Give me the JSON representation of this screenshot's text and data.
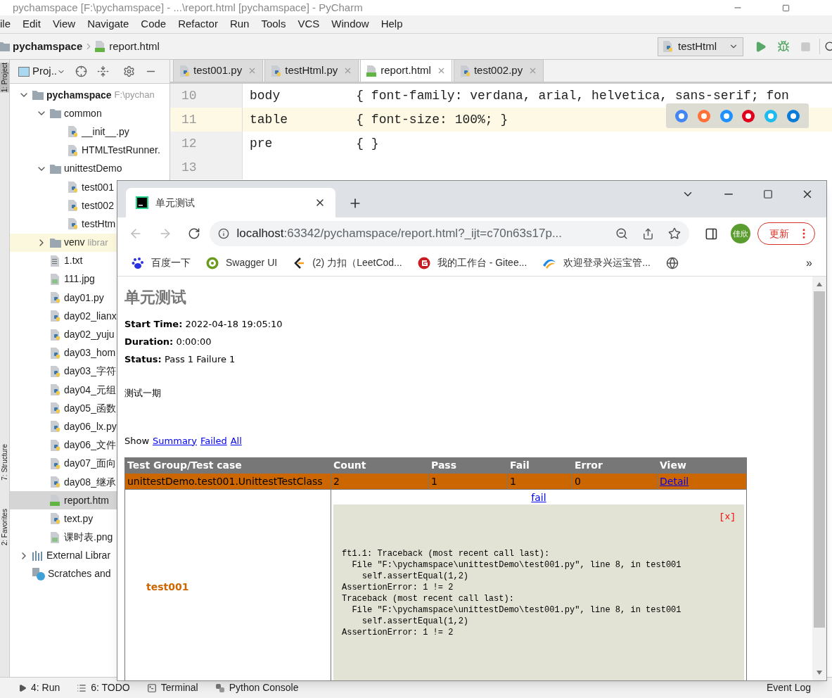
{
  "window": {
    "title": "pychamspace [F:\\pychamspace] - ...\\report.html [pychamspace] - PyCharm"
  },
  "menu": [
    "ile",
    "Edit",
    "View",
    "Navigate",
    "Code",
    "Refactor",
    "Run",
    "Tools",
    "VCS",
    "Window",
    "Help"
  ],
  "breadcrumb": [
    {
      "label": "pychamspace",
      "kind": "folder"
    },
    {
      "label": "report.html",
      "kind": "html"
    }
  ],
  "run_config": {
    "label": "testHtml"
  },
  "left_stripe": [
    {
      "label": "1: Project",
      "selected": true
    },
    {
      "label": "7: Structure",
      "selected": false
    },
    {
      "label": "2: Favorites",
      "selected": false
    }
  ],
  "project_panel": {
    "title": "Proj..",
    "tree": [
      {
        "label": "pychamspace",
        "hint": "F:\\pychan",
        "kind": "folder",
        "expanded": true,
        "selected": false,
        "children": [
          {
            "label": "common",
            "kind": "folder",
            "expanded": true,
            "selected": false,
            "children": [
              {
                "label": "__init__.py",
                "kind": "py",
                "selected": false
              },
              {
                "label": "HTMLTestRunner.",
                "kind": "py",
                "selected": false
              }
            ]
          },
          {
            "label": "unittestDemo",
            "kind": "folder",
            "expanded": true,
            "selected": false,
            "children": [
              {
                "label": "test001",
                "kind": "py",
                "selected": false
              },
              {
                "label": "test002",
                "kind": "py",
                "selected": false
              },
              {
                "label": "testHtm",
                "kind": "py",
                "selected": false
              }
            ]
          },
          {
            "label": "venv",
            "hint": "librar",
            "kind": "library",
            "expanded": false,
            "selected": false
          },
          {
            "label": "1.txt",
            "kind": "txt",
            "selected": false
          },
          {
            "label": "111.jpg",
            "kind": "image",
            "selected": false
          },
          {
            "label": "day01.py",
            "kind": "py",
            "selected": false
          },
          {
            "label": "day02_lianx",
            "kind": "py",
            "selected": false
          },
          {
            "label": "day02_yuju",
            "kind": "py",
            "selected": false
          },
          {
            "label": "day03_hom",
            "kind": "py",
            "selected": false
          },
          {
            "label": "day03_字符",
            "kind": "py",
            "selected": false
          },
          {
            "label": "day04_元组",
            "kind": "py",
            "selected": false
          },
          {
            "label": "day05_函数",
            "kind": "py",
            "selected": false
          },
          {
            "label": "day06_lx.py",
            "kind": "py",
            "selected": false
          },
          {
            "label": "day06_文件",
            "kind": "py",
            "selected": false
          },
          {
            "label": "day07_面向",
            "kind": "py",
            "selected": false
          },
          {
            "label": "day08_继承",
            "kind": "py",
            "selected": false
          },
          {
            "label": "report.htm",
            "kind": "html",
            "selected": true
          },
          {
            "label": "text.py",
            "kind": "py",
            "selected": false
          },
          {
            "label": "课时表.png",
            "kind": "image",
            "selected": false
          }
        ]
      },
      {
        "label": "External Librar",
        "kind": "libs",
        "expanded": false,
        "selected": false
      },
      {
        "label": "Scratches and",
        "kind": "scratch",
        "selected": false
      }
    ]
  },
  "editor": {
    "tabs": [
      {
        "label": "test001.py",
        "kind": "py",
        "selected": false
      },
      {
        "label": "testHtml.py",
        "kind": "py",
        "selected": false
      },
      {
        "label": "report.html",
        "kind": "html",
        "selected": true
      },
      {
        "label": "test002.py",
        "kind": "py",
        "selected": false
      }
    ],
    "lines": [
      {
        "number": "10",
        "text": "body          { font-family: verdana, arial, helvetica, sans-serif; fon",
        "current": false
      },
      {
        "number": "11",
        "text": "table         { font-size: 100%; }",
        "current": true
      },
      {
        "number": "12",
        "text": "pre           { }",
        "current": false
      },
      {
        "number": "13",
        "current": false
      }
    ]
  },
  "browser": {
    "tab_title": "单元测试",
    "address_host": "localhost",
    "address_rest": ":63342/pychamspace/report.html?_ijt=c70n63s17p...",
    "avatar": "佳欣",
    "update_button": "更新",
    "bookmarks": [
      {
        "label": "百度一下",
        "kind": "paw"
      },
      {
        "label": "Swagger UI",
        "kind": "swagger"
      },
      {
        "label": "(2) 力扣（LeetCod...",
        "kind": "leetcode"
      },
      {
        "label": "我的工作台 - Gitee...",
        "kind": "gitee"
      },
      {
        "label": "欢迎登录兴运宝管...",
        "kind": "swirl"
      },
      {
        "kind": "globe"
      }
    ],
    "more": "»",
    "page": {
      "title": "单元测试",
      "meta": [
        {
          "label": "Start Time:",
          "value": "2022-04-18 19:05:10"
        },
        {
          "label": "Duration:",
          "value": "0:00:00"
        },
        {
          "label": "Status:",
          "value": "Pass 1 Failure 1"
        }
      ],
      "description": "测试一期",
      "filter": {
        "label": "Show",
        "links": [
          "Summary",
          "Failed",
          "All"
        ]
      },
      "table": {
        "columns": [
          "Test Group/Test case",
          "Count",
          "Pass",
          "Fail",
          "Error",
          "View"
        ],
        "rows": [
          {
            "color": "#cc6600",
            "cells": [
              "unittestDemo.test001.UnittestTestClass",
              "2",
              "1",
              "1",
              "0"
            ],
            "link": "Detail"
          }
        ]
      },
      "detail": {
        "test": "test001",
        "link": "fail",
        "close": "[x]",
        "trace": "ft1.1: Traceback (most recent call last):\n  File \"F:\\pychamspace\\unittestDemo\\test001.py\", line 8, in test001\n    self.assertEqual(1,2)\nAssertionError: 1 != 2\nTraceback (most recent call last):\n  File \"F:\\pychamspace\\unittestDemo\\test001.py\", line 8, in test001\n    self.assertEqual(1,2)\nAssertionError: 1 != 2"
      }
    }
  },
  "bottom_bar": [
    {
      "label": "4: Run",
      "kind": "run"
    },
    {
      "label": "6: TODO",
      "kind": "todo"
    },
    {
      "label": "Terminal",
      "kind": "terminal"
    },
    {
      "label": "Python Console",
      "kind": "console"
    },
    {
      "label": "Event Log",
      "kind": "log"
    }
  ]
}
